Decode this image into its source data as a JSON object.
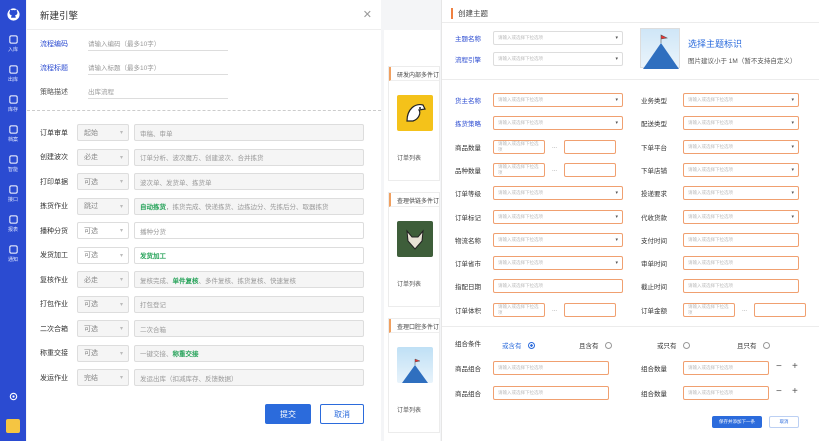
{
  "sidebar": {
    "items": [
      {
        "label": "入库",
        "icon": "inbound-icon"
      },
      {
        "label": "出库",
        "icon": "outbound-icon"
      },
      {
        "label": "库存",
        "icon": "inventory-icon"
      },
      {
        "label": "档案",
        "icon": "archive-icon"
      },
      {
        "label": "智能",
        "icon": "smart-icon"
      },
      {
        "label": "接口",
        "icon": "api-icon"
      },
      {
        "label": "报表",
        "icon": "report-icon"
      },
      {
        "label": "通知",
        "icon": "bell-icon"
      }
    ],
    "brand_color": "#2b4bd1"
  },
  "background": {
    "cards": [
      {
        "header": "研发内部多件订",
        "footer": "订单列表"
      },
      {
        "header": "查理供链多件订",
        "footer": "订单列表"
      },
      {
        "header": "查理口腔多件订",
        "footer": "订单列表"
      }
    ]
  },
  "modal1": {
    "title": "新建引擎",
    "fields": [
      {
        "label": "流程编码",
        "placeholder": "请输入编码（最多10字）"
      },
      {
        "label": "流程标题",
        "placeholder": "请输入标题（最多10字）"
      },
      {
        "label": "策略描述",
        "placeholder": "出库流程"
      }
    ],
    "steps": [
      {
        "label": "订单审单",
        "option": "起始",
        "text": "审稿、审单",
        "green": ""
      },
      {
        "label": "创建波次",
        "option": "必走",
        "text": "订单分析、波次魔方、创建波次、合并拣货",
        "green": ""
      },
      {
        "label": "打印单据",
        "option": "可选",
        "text": "波次单、发货单、拣货单",
        "green": ""
      },
      {
        "label": "拣货作业",
        "option": "跳过",
        "text": "，拣货完成、快递拣货、边拣边分、先拣后分、取器拣货",
        "green": "自动拣货"
      },
      {
        "label": "播种分货",
        "option": "可选",
        "text": "播种分货",
        "green": ""
      },
      {
        "label": "发货加工",
        "option": "可选",
        "text": "",
        "green": "发货加工"
      },
      {
        "label": "复核作业",
        "option": "必走",
        "text": "复核完成、",
        "green": "单件复核",
        "text2": "、多件复核、拣货复核、快速复核"
      },
      {
        "label": "打包作业",
        "option": "可选",
        "text": "打包登记",
        "green": ""
      },
      {
        "label": "二次合箱",
        "option": "可选",
        "text": "二次合箱",
        "green": ""
      },
      {
        "label": "称重交接",
        "option": "可选",
        "text": "一键交接、",
        "green": "称重交接"
      },
      {
        "label": "发运作业",
        "option": "完结",
        "text": "发运出库（扣减库存、反馈数据）",
        "green": ""
      }
    ],
    "submit": "提交",
    "cancel": "取消"
  },
  "panel2": {
    "title": "创建主题",
    "name_label": "主题名称",
    "engine_label": "流程引擎",
    "upload_title": "选择主题标识",
    "upload_hint": "图片建议小于 1M（暂不支持自定义）",
    "ph": "请输入或选择下拉选项",
    "left_fields": [
      "货主名称",
      "拣货策略",
      "商品数量",
      "品种数量",
      "订单等级",
      "订单标记",
      "物流名称",
      "订单省市",
      "指配日期",
      "订单体积"
    ],
    "right_fields": [
      "业务类型",
      "配送类型",
      "下单平台",
      "下单店铺",
      "投递要求",
      "代收货款",
      "支付时间",
      "审单时间",
      "截止时间",
      "订单金额"
    ],
    "combo_label": "组合条件",
    "radios": [
      "或含有",
      "且含有",
      "或只有",
      "且只有"
    ],
    "goods_label": "商品组合",
    "qty_label": "组合数量",
    "save": "保存并添加下一条",
    "cancel": "取消"
  }
}
